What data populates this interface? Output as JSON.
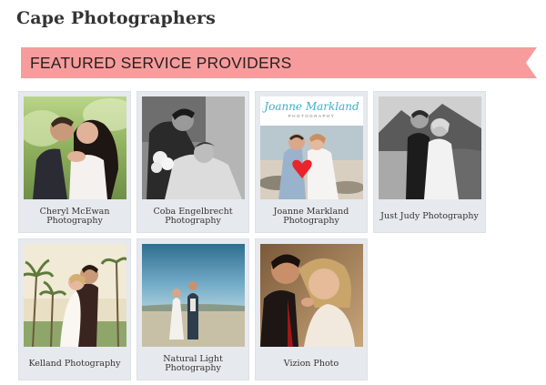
{
  "page": {
    "title": "Cape Photographers"
  },
  "banner": {
    "title": "FEATURED SERVICE PROVIDERS",
    "color": "#f79c9c"
  },
  "providers": [
    {
      "name": "Cheryl McEwan Photography",
      "photo": "couple-embrace-garden"
    },
    {
      "name": "Coba Engelbrecht Photography",
      "photo": "couple-black-white-flowers"
    },
    {
      "name": "Joanne Markland Photography",
      "photo": "couple-beach-heart-balloon",
      "logo_text": "Joanne Markland",
      "logo_sub": "PHOTOGRAPHY"
    },
    {
      "name": "Just Judy Photography",
      "photo": "couple-black-white-mountain"
    },
    {
      "name": "Kelland Photography",
      "photo": "couple-kiss-palm-trees"
    },
    {
      "name": "Natural Light Photography",
      "photo": "couple-beach-sky"
    },
    {
      "name": "Vizion Photo",
      "photo": "couple-portrait-sepia"
    }
  ]
}
